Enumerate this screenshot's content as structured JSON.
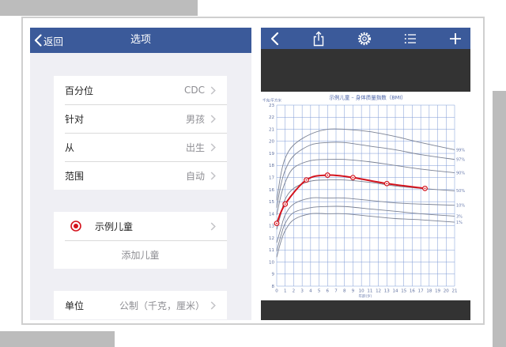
{
  "colors": {
    "nav_bar": "#3b5a9a",
    "dark_band": "#333333",
    "list_background": "#efeff4",
    "accent_red": "#d4121c",
    "grid": "#7d9ad6",
    "percentile_curve": "#7b8294"
  },
  "options_screen": {
    "nav": {
      "back_icon": "chevron-left-icon",
      "back_label": "返回",
      "title": "选项"
    },
    "settings": [
      {
        "label": "百分位",
        "value": "CDC"
      },
      {
        "label": "针对",
        "value": "男孩"
      },
      {
        "label": "从",
        "value": "出生"
      },
      {
        "label": "范围",
        "value": "自动"
      }
    ],
    "children": [
      {
        "icon": "radio-selected-icon",
        "name": "示例儿童",
        "selected": true
      }
    ],
    "add_child_label": "添加儿童",
    "units": {
      "label": "单位",
      "value": "公制（千克，厘米）"
    }
  },
  "chart_screen": {
    "toolbar_icons": [
      "chevron-left-icon",
      "share-icon",
      "gear-icon",
      "list-icon",
      "plus-icon"
    ]
  },
  "chart_data": {
    "type": "line",
    "title": "示例儿童 – 身体质量指数（BMI）",
    "ylabel": "千克/平方米",
    "xlabel": "年龄(岁)",
    "xlim": [
      0,
      21
    ],
    "ylim": [
      8,
      23
    ],
    "x_ticks": [
      0,
      1,
      2,
      3,
      4,
      5,
      6,
      7,
      8,
      9,
      10,
      11,
      12,
      13,
      14,
      15,
      16,
      17,
      18,
      19,
      20,
      21
    ],
    "y_ticks": [
      8,
      9,
      10,
      11,
      12,
      13,
      14,
      15,
      16,
      17,
      18,
      19,
      20,
      21,
      22,
      23
    ],
    "grid": true,
    "percentile_ages": [
      0,
      0.5,
      1,
      2,
      4,
      6,
      8,
      11,
      14,
      17,
      21
    ],
    "percentiles": [
      {
        "name": "99%",
        "values": [
          15.1,
          17.3,
          18.6,
          19.7,
          20.6,
          21.0,
          21.0,
          20.8,
          20.4,
          19.9,
          19.3
        ]
      },
      {
        "name": "97%",
        "values": [
          14.5,
          16.4,
          17.6,
          18.8,
          19.7,
          19.9,
          19.9,
          19.6,
          19.3,
          18.9,
          18.5
        ]
      },
      {
        "name": "90%",
        "values": [
          13.9,
          15.5,
          16.6,
          17.8,
          18.4,
          18.5,
          18.5,
          18.3,
          18.0,
          17.7,
          17.4
        ]
      },
      {
        "name": "50%",
        "values": [
          12.7,
          14.0,
          15.2,
          16.1,
          16.7,
          16.8,
          16.8,
          16.6,
          16.3,
          16.1,
          15.9
        ]
      },
      {
        "name": "10%",
        "values": [
          11.6,
          12.8,
          13.9,
          14.8,
          15.3,
          15.3,
          15.3,
          15.1,
          14.9,
          14.8,
          14.7
        ]
      },
      {
        "name": "3%",
        "values": [
          10.9,
          12.2,
          13.2,
          14.1,
          14.5,
          14.6,
          14.6,
          14.4,
          14.2,
          14.0,
          13.8
        ]
      },
      {
        "name": "1%",
        "values": [
          10.4,
          11.7,
          12.6,
          13.5,
          14.0,
          14.0,
          14.0,
          13.8,
          13.6,
          13.5,
          13.3
        ]
      }
    ],
    "child": {
      "x": [
        0,
        1,
        3.5,
        6,
        9,
        13,
        17.5
      ],
      "y": [
        13.2,
        14.8,
        16.8,
        17.2,
        17.0,
        16.5,
        16.1
      ]
    }
  }
}
